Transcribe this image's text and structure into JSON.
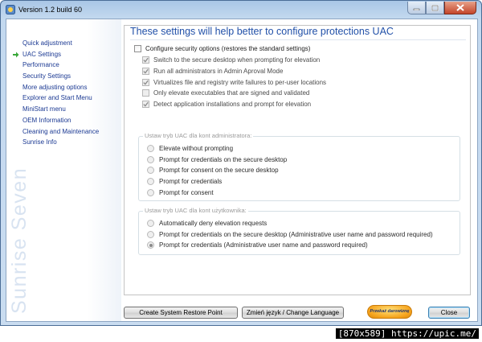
{
  "window": {
    "title": "Version 1.2 build 60"
  },
  "sidebar": {
    "items": [
      {
        "label": "Quick adjustment"
      },
      {
        "label": "UAC Settings",
        "selected": true
      },
      {
        "label": "Performance"
      },
      {
        "label": "Security Settings"
      },
      {
        "label": "More adjusting options"
      },
      {
        "label": "Explorer and Start Menu"
      },
      {
        "label": "MiniStart menu"
      },
      {
        "label": "OEM Information"
      },
      {
        "label": "Cleaning and Maintenance"
      },
      {
        "label": "Sunrise Info"
      }
    ],
    "brand": "Sunrise Seven"
  },
  "main": {
    "heading": "These settings will help better to configure protections UAC",
    "master_checkbox": {
      "label": "Configure security options (restores the standard settings)",
      "checked": false
    },
    "options": [
      {
        "label": "Switch to the secure desktop when prompting for elevation",
        "checked": true
      },
      {
        "label": "Run all administrators in Admin Aproval Mode",
        "checked": true
      },
      {
        "label": "Virtualizes file and registry write failures to per-user locations",
        "checked": true
      },
      {
        "label": "Only elevate executables that are signed and validated",
        "checked": false
      },
      {
        "label": "Detect application installations and prompt for elevation",
        "checked": true
      }
    ],
    "admin_group": {
      "title": "Ustaw tryb UAC dla kont administratora:",
      "options": [
        {
          "label": "Elevate without prompting",
          "selected": false
        },
        {
          "label": "Prompt for credentials on the secure desktop",
          "selected": false
        },
        {
          "label": "Prompt for consent on the secure desktop",
          "selected": false
        },
        {
          "label": "Prompt for credentials",
          "selected": false
        },
        {
          "label": "Prompt for consent",
          "selected": false
        }
      ]
    },
    "user_group": {
      "title": "Ustaw tryb UAC dla kont użytkownika:",
      "options": [
        {
          "label": "Automatically deny elevation requests",
          "selected": false
        },
        {
          "label": "Prompt for credentials on the secure desktop (Administrative user name and password required)",
          "selected": false
        },
        {
          "label": "Prompt for credentials (Administrative user name and password required)",
          "selected": true
        }
      ]
    }
  },
  "buttons": {
    "restore_point": "Create System Restore Point",
    "language": "Zmień język / Change Language",
    "donate": "Przekaż darowiznę",
    "close": "Close"
  },
  "watermark": "[870x589] https://upic.me/",
  "colors": {
    "heading": "#2150a8",
    "nav_link": "#1c3a93",
    "selected_arrow": "#3aa83a",
    "donate": "#f5a21b"
  }
}
